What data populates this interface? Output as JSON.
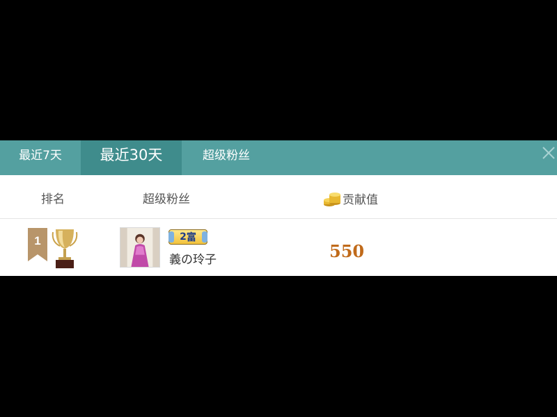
{
  "tabs": [
    {
      "label": "最近7天",
      "active": false
    },
    {
      "label": "最近30天",
      "active": true
    },
    {
      "label": "超级粉丝",
      "active": false
    }
  ],
  "close_icon": "close-icon",
  "columns": {
    "rank": "排名",
    "fans": "超级粉丝",
    "contribution": "贡献值"
  },
  "rows": [
    {
      "rank": "1",
      "badge_level": "2",
      "badge_text": "富",
      "name": "義の玲子",
      "contribution": "550"
    }
  ],
  "colors": {
    "tabbar": "#54a0a0",
    "active_tab": "#3f8c8c",
    "contribution": "#c06a1a"
  }
}
